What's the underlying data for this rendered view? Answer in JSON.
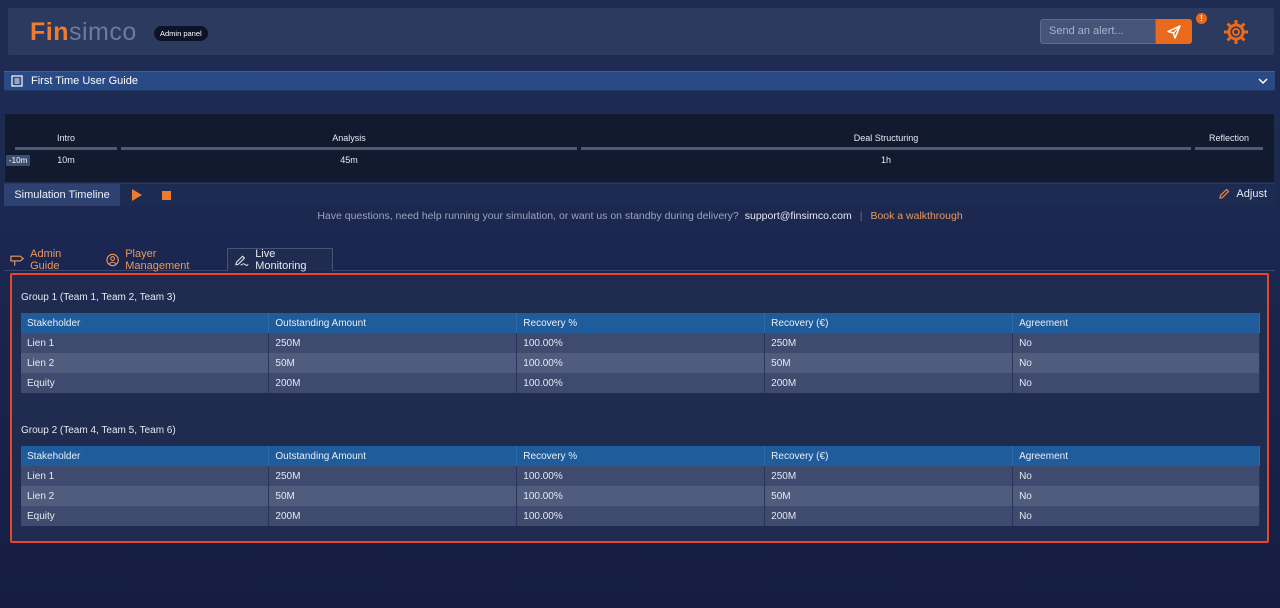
{
  "header": {
    "logo_fin": "Fin",
    "logo_simco": "simco",
    "admin_badge": "Admin panel",
    "alert_placeholder": "Send an alert...",
    "notification_count": "!"
  },
  "guide": {
    "title": "First Time User Guide"
  },
  "timeline": {
    "marker": "-10m",
    "phases": [
      {
        "name": "Intro",
        "duration": "10m"
      },
      {
        "name": "Analysis",
        "duration": "45m"
      },
      {
        "name": "Deal Structuring",
        "duration": "1h"
      },
      {
        "name": "Reflection",
        "duration": ""
      }
    ],
    "label": "Simulation Timeline",
    "adjust_label": "Adjust"
  },
  "help": {
    "text": "Have questions, need help running your simulation, or want us on standby during delivery?",
    "email": "support@finsimco.com",
    "separator": "|",
    "walkthrough": "Book a walkthrough"
  },
  "tabs": [
    {
      "label": "Admin Guide",
      "active": false
    },
    {
      "label": "Player Management",
      "active": false
    },
    {
      "label": "Live Monitoring",
      "active": true
    }
  ],
  "columns": [
    "Stakeholder",
    "Outstanding Amount",
    "Recovery %",
    "Recovery (€)",
    "Agreement"
  ],
  "groups": [
    {
      "title": "Group 1 (Team 1, Team 2, Team 3)",
      "rows": [
        [
          "Lien 1",
          "250M",
          "100.00%",
          "250M",
          "No"
        ],
        [
          "Lien 2",
          "50M",
          "100.00%",
          "50M",
          "No"
        ],
        [
          "Equity",
          "200M",
          "100.00%",
          "200M",
          "No"
        ]
      ]
    },
    {
      "title": "Group 2 (Team 4, Team 5, Team 6)",
      "rows": [
        [
          "Lien 1",
          "250M",
          "100.00%",
          "250M",
          "No"
        ],
        [
          "Lien 2",
          "50M",
          "100.00%",
          "50M",
          "No"
        ],
        [
          "Equity",
          "200M",
          "100.00%",
          "200M",
          "No"
        ]
      ]
    }
  ],
  "colors": {
    "accent": "#ea6a1c",
    "table_header": "#1e5c9c",
    "highlight_border": "#e8452a"
  }
}
